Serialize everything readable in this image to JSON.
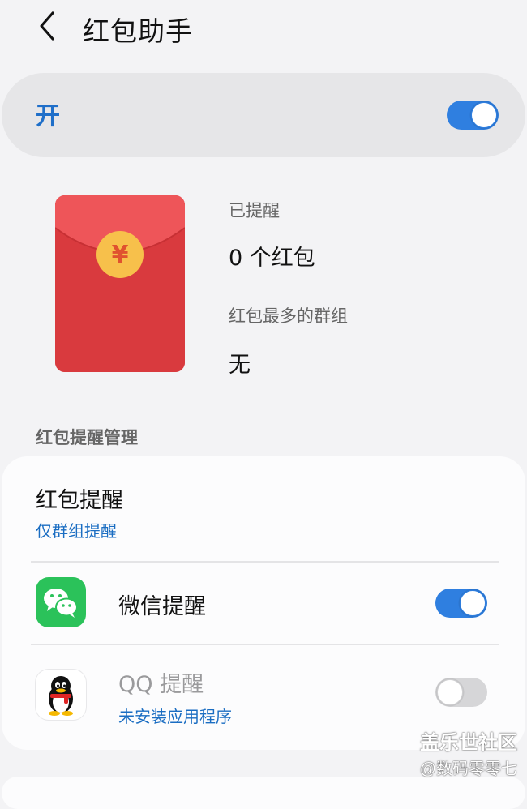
{
  "header": {
    "title": "红包助手"
  },
  "master": {
    "label": "开",
    "enabled": true
  },
  "stats": {
    "reminded_label": "已提醒",
    "reminded_value": "0 个红包",
    "top_group_label": "红包最多的群组",
    "top_group_value": "无",
    "envelope_symbol": "¥"
  },
  "section": {
    "title": "红包提醒管理"
  },
  "settings": {
    "reminder": {
      "title": "红包提醒",
      "subtitle": "仅群组提醒"
    },
    "wechat": {
      "title": "微信提醒",
      "enabled": true
    },
    "qq": {
      "title": "QQ 提醒",
      "subtitle": "未安装应用程序",
      "enabled": false
    }
  },
  "watermark": {
    "line1": "盖乐世社区",
    "line2": "@数码零零七"
  },
  "colors": {
    "accent": "#2f7fe0",
    "link": "#1a6dc2",
    "envelope_red": "#d93a3e",
    "coin": "#f7c04b",
    "wechat_green": "#2bc25a"
  }
}
